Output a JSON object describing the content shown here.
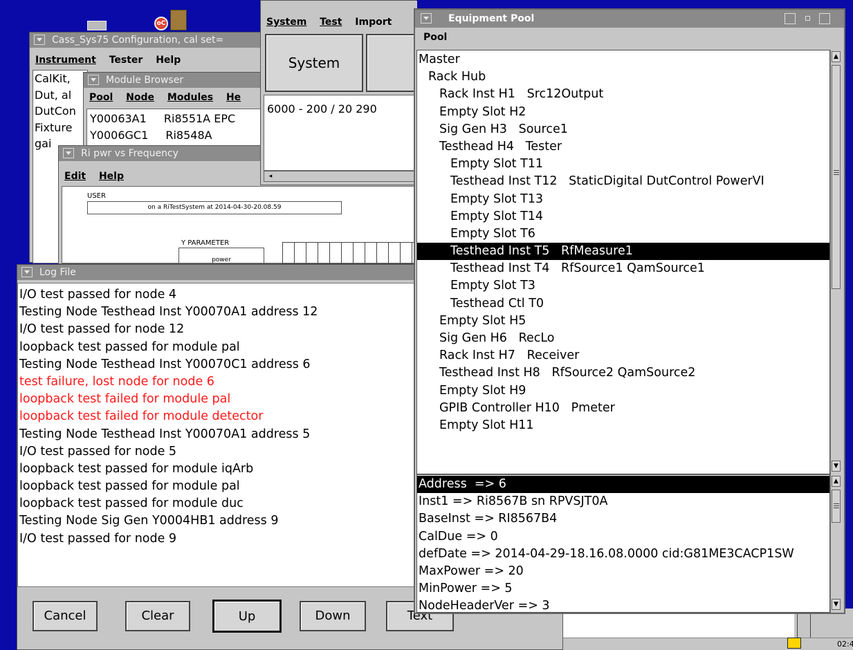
{
  "taskbar": {
    "clock": "02:4"
  },
  "desktop": {
    "app_icon_label": "oC"
  },
  "config_window": {
    "title": "Cass_Sys75 Configuration, cal set=",
    "menu": [
      "Instrument",
      "Tester",
      "Help"
    ],
    "lines": [
      "CalKit,",
      "Dut, al",
      "DutCon",
      "Fixture",
      "gai"
    ]
  },
  "module_browser": {
    "title": "Module Browser",
    "menu": [
      "Pool",
      "Node",
      "Modules",
      "He"
    ],
    "rows": [
      [
        "Y00063A1",
        "Ri8551A EPC"
      ],
      [
        "Y0006GC1",
        "Ri8548A"
      ]
    ]
  },
  "plot_window": {
    "title": "Ri pwr vs Frequency",
    "menu": [
      "Edit",
      "Help"
    ],
    "user_label": "USER",
    "run_text": "on a RiTestSystem at 2014-04-30-20.08.59",
    "y_param_label": "Y PARAMETER",
    "y_value": "power"
  },
  "system_window": {
    "menu": [
      "System",
      "Test",
      "Import"
    ],
    "button_label": "System",
    "text": "6000 - 200 / 20 290"
  },
  "log_window": {
    "title": "Log File",
    "colors": {
      "normal": "#000000",
      "error": "#ff1a1a"
    },
    "lines": [
      {
        "text": "I/O test passed for node 4",
        "error": false
      },
      {
        "text": "Testing Node Testhead Inst  Y00070A1  address 12",
        "error": false
      },
      {
        "text": "I/O test passed for node 12",
        "error": false
      },
      {
        "text": "loopback test passed for module pal",
        "error": false
      },
      {
        "text": "Testing Node Testhead Inst  Y00070C1  address 6",
        "error": false
      },
      {
        "text": "test failure, lost node for node 6",
        "error": true
      },
      {
        "text": "loopback test failed for module pal",
        "error": true
      },
      {
        "text": "loopback test failed for module detector",
        "error": true
      },
      {
        "text": "Testing Node Testhead Inst  Y00070A1  address 5",
        "error": false
      },
      {
        "text": "I/O test passed for node 5",
        "error": false
      },
      {
        "text": "loopback test passed for module iqArb",
        "error": false
      },
      {
        "text": "loopback test passed for module pal",
        "error": false
      },
      {
        "text": "loopback test passed for module duc",
        "error": false
      },
      {
        "text": "Testing Node Sig Gen  Y0004HB1  address 9",
        "error": false
      },
      {
        "text": "I/O test passed for node 9",
        "error": false
      }
    ],
    "buttons": {
      "cancel": "Cancel",
      "clear": "Clear",
      "up": "Up",
      "down": "Down",
      "text": "Text"
    }
  },
  "equipment_pool": {
    "title": "Equipment Pool",
    "menu": [
      "Pool"
    ],
    "tree": [
      {
        "text": "Master",
        "level": 0,
        "selected": false
      },
      {
        "text": "Rack Hub",
        "level": 1,
        "selected": false
      },
      {
        "text": "Rack Inst H1   Src12Output",
        "level": 2,
        "selected": false
      },
      {
        "text": "Empty Slot H2",
        "level": 2,
        "selected": false
      },
      {
        "text": "Sig Gen H3   Source1",
        "level": 2,
        "selected": false
      },
      {
        "text": "Testhead H4   Tester",
        "level": 2,
        "selected": false
      },
      {
        "text": "Empty Slot T11",
        "level": 3,
        "selected": false
      },
      {
        "text": "Testhead Inst T12   StaticDigital DutControl PowerVI",
        "level": 3,
        "selected": false
      },
      {
        "text": "Empty Slot T13",
        "level": 3,
        "selected": false
      },
      {
        "text": "Empty Slot T14",
        "level": 3,
        "selected": false
      },
      {
        "text": "Empty Slot T6",
        "level": 3,
        "selected": false
      },
      {
        "text": "Testhead Inst T5   RfMeasure1",
        "level": 3,
        "selected": true
      },
      {
        "text": "Testhead Inst T4   RfSource1 QamSource1",
        "level": 3,
        "selected": false
      },
      {
        "text": "Empty Slot T3",
        "level": 3,
        "selected": false
      },
      {
        "text": "Testhead Ctl T0",
        "level": 3,
        "selected": false
      },
      {
        "text": "Empty Slot H5",
        "level": 2,
        "selected": false
      },
      {
        "text": "Sig Gen H6   RecLo",
        "level": 2,
        "selected": false
      },
      {
        "text": "Rack Inst H7   Receiver",
        "level": 2,
        "selected": false
      },
      {
        "text": "Testhead Inst H8   RfSource2 QamSource2",
        "level": 2,
        "selected": false
      },
      {
        "text": "Empty Slot H9",
        "level": 2,
        "selected": false
      },
      {
        "text": "GPIB Controller H10   Pmeter",
        "level": 2,
        "selected": false
      },
      {
        "text": "Empty Slot H11",
        "level": 2,
        "selected": false
      }
    ],
    "properties": [
      {
        "text": "Address  => 6",
        "selected": true
      },
      {
        "text": "Inst1 => Ri8567B sn RPVSJT0A",
        "selected": false
      },
      {
        "text": "BaseInst => RI8567B4",
        "selected": false
      },
      {
        "text": "CalDue => 0",
        "selected": false
      },
      {
        "text": "defDate => 2014-04-29-18.16.08.0000 cid:G81ME3CACP1SW",
        "selected": false
      },
      {
        "text": "MaxPower => 20",
        "selected": false
      },
      {
        "text": "MinPower => 5",
        "selected": false
      },
      {
        "text": "NodeHeaderVer => 3",
        "selected": false
      }
    ]
  }
}
